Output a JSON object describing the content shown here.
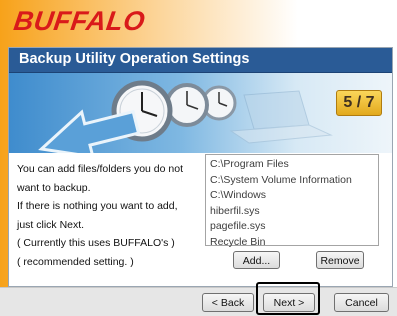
{
  "brand": {
    "logo_text": "BUFFALO"
  },
  "window": {
    "title": "Backup Utility Operation Settings"
  },
  "step": {
    "label": "5 / 7"
  },
  "description": {
    "lines": [
      "You can add files/folders you do not",
      "want to backup.",
      "If there is nothing you want to add,",
      "just click Next.",
      "( Currently this uses BUFFALO's )",
      "( recommended setting. )"
    ]
  },
  "exclusions": {
    "items": [
      "C:\\Program Files",
      "C:\\System Volume Information",
      "C:\\Windows",
      "hiberfil.sys",
      "pagefile.sys",
      "Recycle Bin"
    ]
  },
  "buttons": {
    "add": "Add...",
    "remove": "Remove",
    "back": "< Back",
    "next": "Next >",
    "cancel": "Cancel"
  },
  "colors": {
    "brand_red": "#d91a1a",
    "title_bar": "#2a5b96",
    "step_badge": "#f0c040"
  },
  "icons": {
    "banner": "clocks-and-laptop-illustration",
    "arrow": "backup-arrow-icon"
  }
}
